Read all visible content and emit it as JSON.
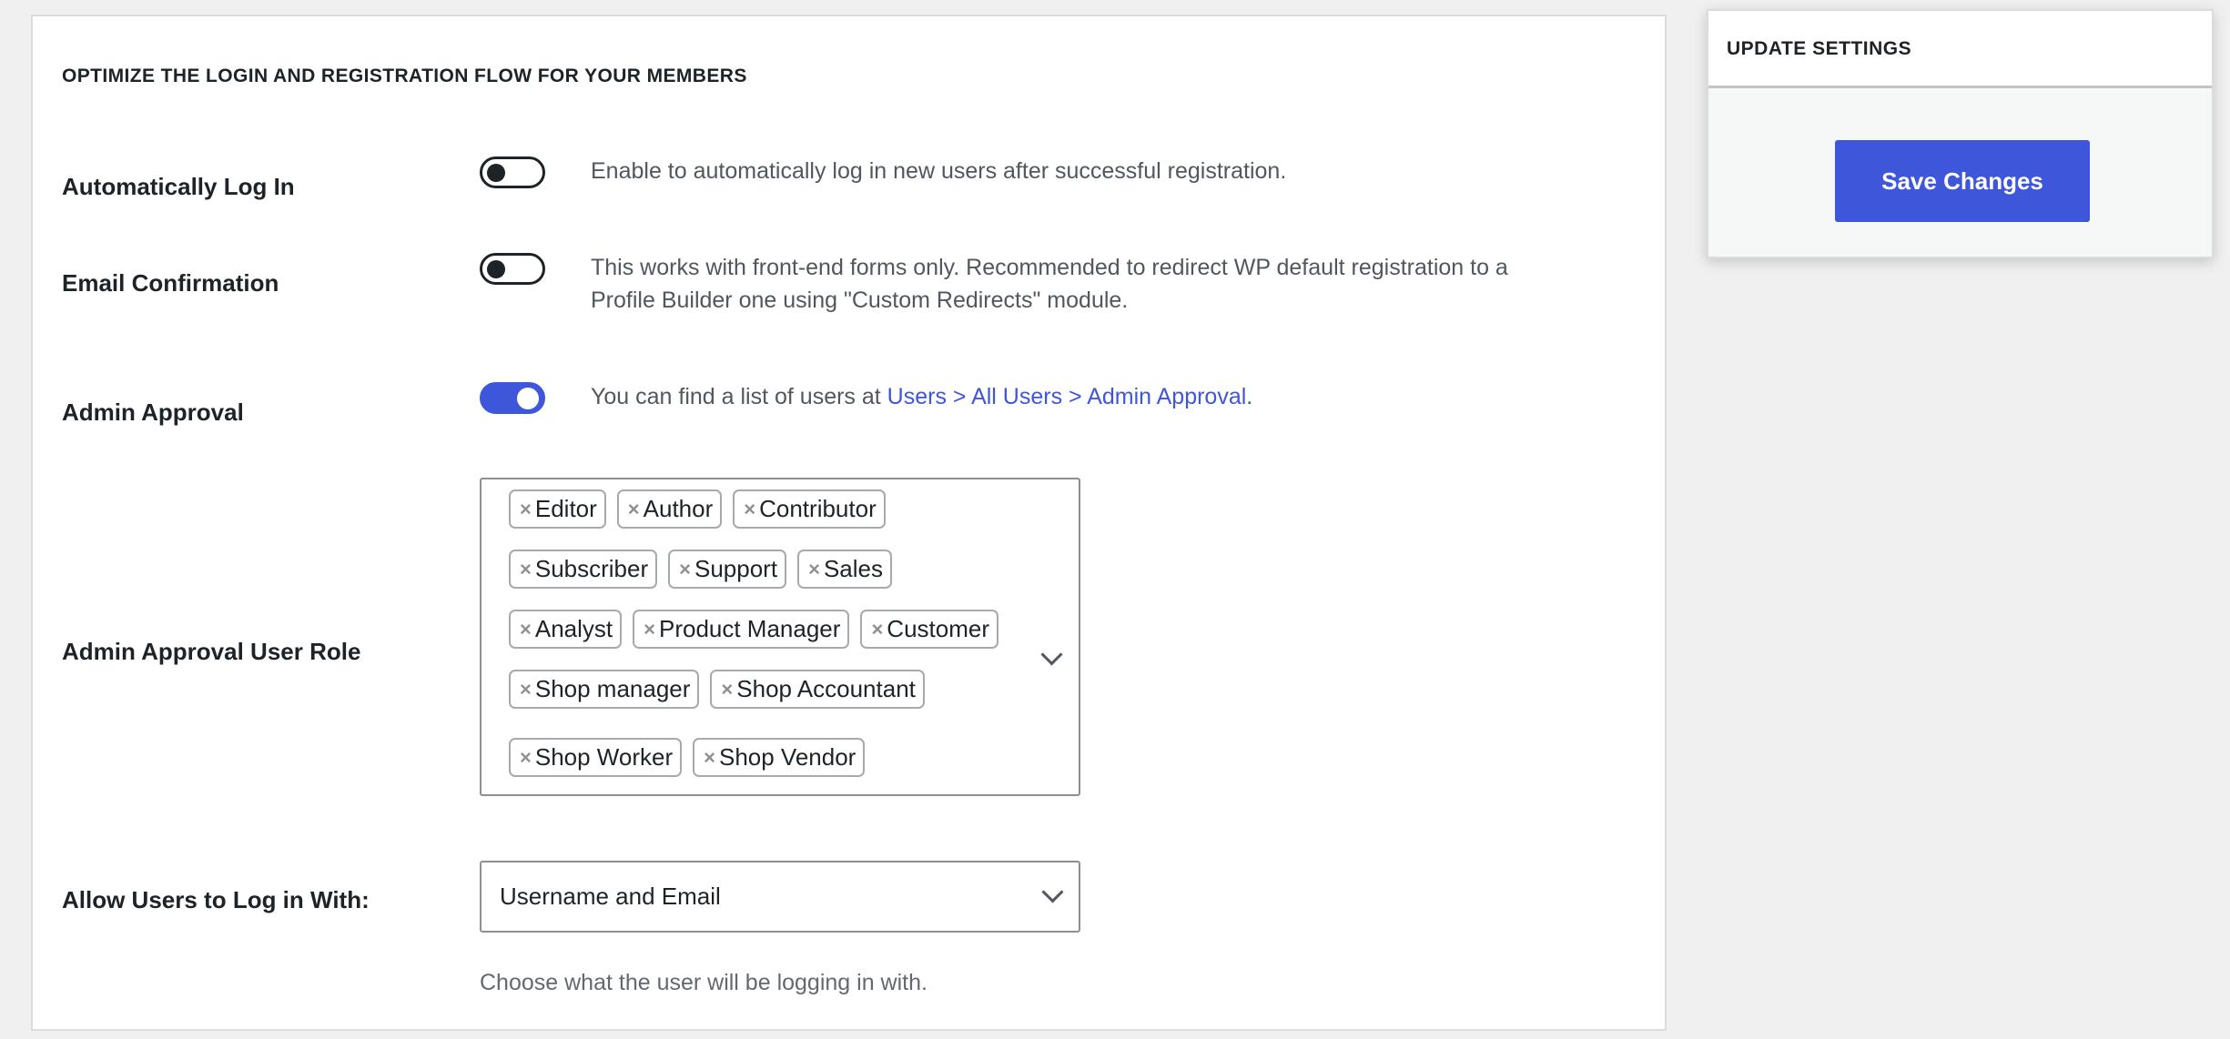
{
  "main": {
    "section_title": "OPTIMIZE THE LOGIN AND REGISTRATION FLOW FOR YOUR MEMBERS",
    "auto_login": {
      "label": "Automatically Log In",
      "enabled": false,
      "description": "Enable to automatically log in new users after successful registration."
    },
    "email_confirmation": {
      "label": "Email Confirmation",
      "enabled": false,
      "description_line1": "This works with front-end forms only. Recommended to redirect WP default registration to a",
      "description_line2": "Profile Builder one using \"Custom Redirects\" module."
    },
    "admin_approval": {
      "label": "Admin Approval",
      "enabled": true,
      "description_prefix": "You can find a list of users at ",
      "link_text": "Users > All Users > Admin Approval",
      "description_suffix": "."
    },
    "admin_approval_roles": {
      "label": "Admin Approval User Role",
      "remove_glyph": "×",
      "rows": [
        [
          "Editor",
          "Author",
          "Contributor"
        ],
        [
          "Subscriber",
          "Support",
          "Sales"
        ],
        [
          "Analyst",
          "Product Manager",
          "Customer"
        ],
        [
          "Shop manager",
          "Shop Accountant"
        ],
        [
          "Shop Worker",
          "Shop Vendor"
        ]
      ]
    },
    "login_with": {
      "label": "Allow Users to Log in With:",
      "selected": "Username and Email",
      "helper": "Choose what the user will be logging in with."
    }
  },
  "sidebar": {
    "title": "UPDATE SETTINGS",
    "save_label": "Save Changes"
  },
  "colors": {
    "accent": "#3e56da",
    "background": "#f0f0f1",
    "text": "#1d2327",
    "muted_text": "#50575e"
  }
}
